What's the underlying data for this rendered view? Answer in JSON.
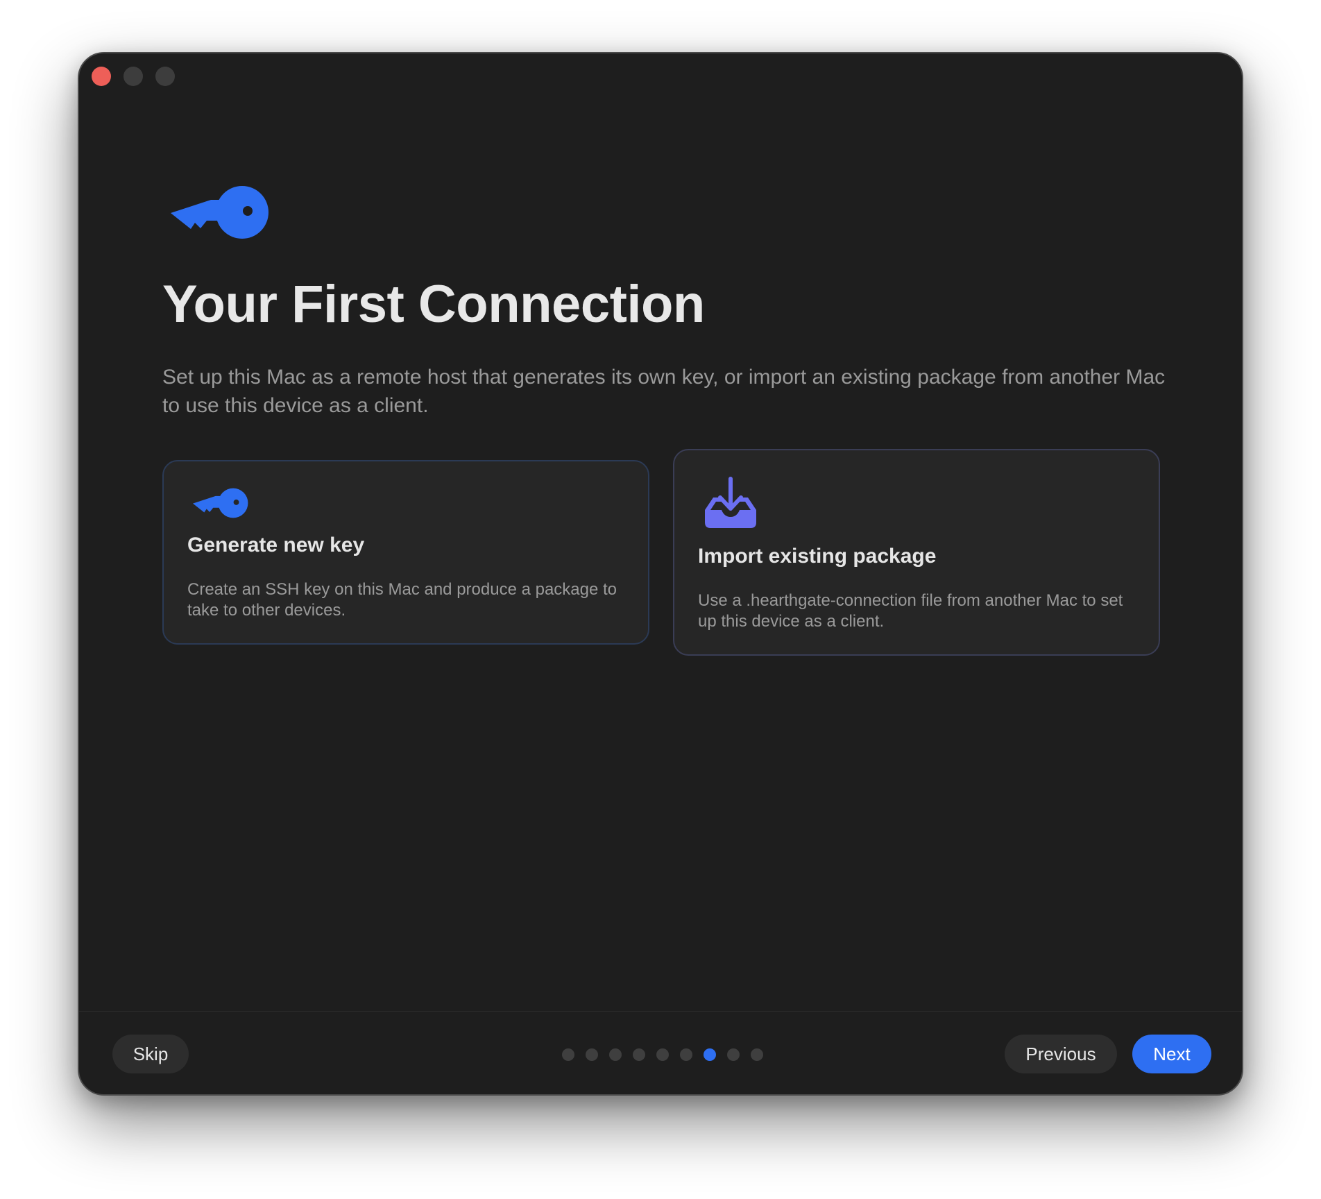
{
  "window": {
    "title": ""
  },
  "onboarding": {
    "title": "Your First Connection",
    "subtitle": "Set up this Mac as a remote host that generates its own key, or import an existing package from another Mac to use this device as a client.",
    "hero_icon": "key-icon"
  },
  "cards": [
    {
      "icon": "key-icon",
      "title": "Generate new key",
      "description": "Create an SSH key on this Mac and produce a package to take to other devices."
    },
    {
      "icon": "tray-download-icon",
      "title": "Import existing package",
      "description": "Use a .hearthgate-connection file from another Mac to set up this device as a client."
    }
  ],
  "footer": {
    "skip_label": "Skip",
    "previous_label": "Previous",
    "next_label": "Next",
    "page_count": 9,
    "current_page": 7
  },
  "colors": {
    "accent": "#2e6ff2",
    "import_icon": "#6b6ff2",
    "close": "#ee5f58",
    "background": "#1e1e1e"
  }
}
